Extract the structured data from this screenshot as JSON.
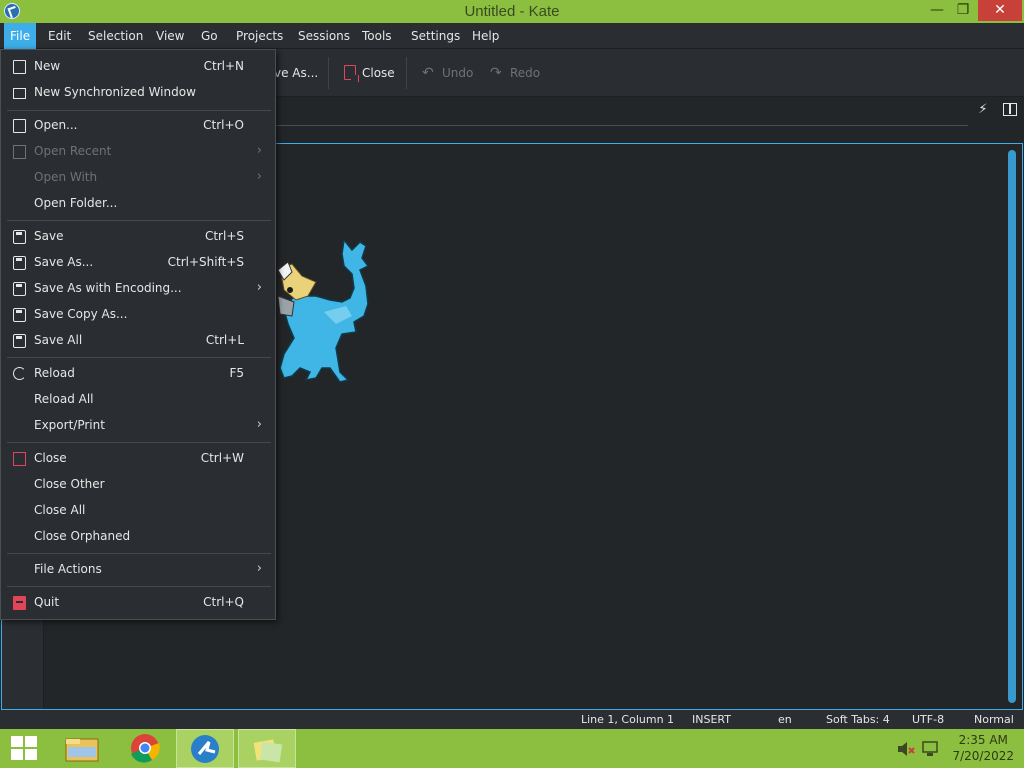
{
  "window": {
    "title": "Untitled  - Kate",
    "min_glyph": "—",
    "max_glyph": "❐",
    "close_glyph": "✕"
  },
  "menubar": {
    "items": [
      "File",
      "Edit",
      "Selection",
      "View",
      "Go",
      "Projects",
      "Sessions",
      "Tools",
      "Settings",
      "Help"
    ],
    "active": "File"
  },
  "toolbar": {
    "save_as_partial": "ve As...",
    "close": "Close",
    "undo": "Undo",
    "redo": "Redo"
  },
  "file_menu": {
    "items": [
      {
        "label": "New",
        "shortcut": "Ctrl+N",
        "icon": "new-doc-icon"
      },
      {
        "label": "New Synchronized Window",
        "shortcut": "",
        "icon": "new-window-icon"
      },
      {
        "label": "Open...",
        "shortcut": "Ctrl+O",
        "icon": "open-doc-icon"
      },
      {
        "label": "Open Recent",
        "shortcut": "",
        "icon": "open-recent-icon",
        "disabled": true,
        "submenu": true
      },
      {
        "label": "Open With",
        "shortcut": "",
        "disabled": true,
        "submenu": true
      },
      {
        "label": "Open Folder...",
        "shortcut": ""
      },
      {
        "label": "Save",
        "shortcut": "Ctrl+S",
        "icon": "save-icon"
      },
      {
        "label": "Save As...",
        "shortcut": "Ctrl+Shift+S",
        "icon": "save-as-icon"
      },
      {
        "label": "Save As with Encoding...",
        "shortcut": "",
        "icon": "save-encoding-icon",
        "submenu": true
      },
      {
        "label": "Save Copy As...",
        "shortcut": "",
        "icon": "save-copy-icon"
      },
      {
        "label": "Save All",
        "shortcut": "Ctrl+L",
        "icon": "save-all-icon"
      },
      {
        "label": "Reload",
        "shortcut": "F5",
        "icon": "reload-icon"
      },
      {
        "label": "Reload All",
        "shortcut": ""
      },
      {
        "label": "Export/Print",
        "shortcut": "",
        "submenu": true
      },
      {
        "label": "Close",
        "shortcut": "Ctrl+W",
        "icon": "close-doc-icon"
      },
      {
        "label": "Close Other",
        "shortcut": ""
      },
      {
        "label": "Close All",
        "shortcut": ""
      },
      {
        "label": "Close Orphaned",
        "shortcut": ""
      },
      {
        "label": "File Actions",
        "shortcut": "",
        "submenu": true
      },
      {
        "label": "Quit",
        "shortcut": "Ctrl+Q",
        "icon": "quit-icon"
      }
    ],
    "submenu_arrow": "›"
  },
  "statusbar": {
    "position": "Line 1, Column 1",
    "mode": "INSERT",
    "language": "en",
    "indent": "Soft Tabs: 4",
    "encoding": "UTF-8",
    "highlight": "Normal"
  },
  "taskbar": {
    "time": "2:35 AM",
    "date": "7/20/2022"
  },
  "colors": {
    "accent": "#3daee9",
    "titlebar": "#8cbf3f",
    "close_red": "#c7403a",
    "icon_red": "#e0455a"
  }
}
